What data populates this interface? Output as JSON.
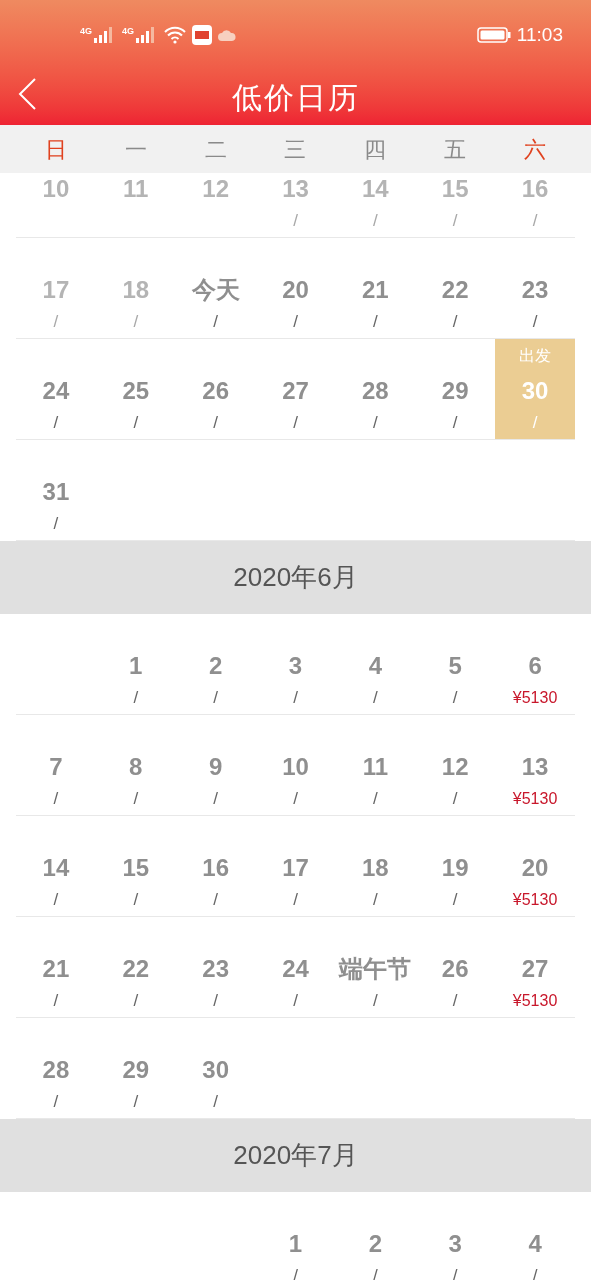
{
  "status_bar": {
    "network_1": "4G",
    "network_2": "4G",
    "time": "11:03"
  },
  "header": {
    "title": "低价日历"
  },
  "weekdays": [
    {
      "label": "日",
      "color": "#e0421f"
    },
    {
      "label": "一",
      "color": "#8a8a8a"
    },
    {
      "label": "二",
      "color": "#8a8a8a"
    },
    {
      "label": "三",
      "color": "#8a8a8a"
    },
    {
      "label": "四",
      "color": "#8a8a8a"
    },
    {
      "label": "五",
      "color": "#8a8a8a"
    },
    {
      "label": "六",
      "color": "#e0421f"
    }
  ],
  "months": [
    {
      "weeks": [
        [
          {
            "kind": "past",
            "day": "10"
          },
          {
            "kind": "past",
            "day": "11"
          },
          {
            "kind": "past",
            "day": "12"
          },
          {
            "kind": "past",
            "day": "13",
            "note": {
              "kind": "none",
              "text": "/"
            }
          },
          {
            "kind": "past",
            "day": "14",
            "note": {
              "kind": "none",
              "text": "/"
            }
          },
          {
            "kind": "past",
            "day": "15",
            "note": {
              "kind": "none",
              "text": "/"
            }
          },
          {
            "kind": "past",
            "day": "16",
            "note": {
              "kind": "none",
              "text": "/"
            }
          }
        ],
        [
          {
            "kind": "past",
            "day": "17",
            "note": {
              "kind": "none",
              "text": "/"
            }
          },
          {
            "kind": "past",
            "day": "18",
            "note": {
              "kind": "none",
              "text": "/"
            }
          },
          {
            "kind": "normal",
            "day": "今天",
            "note": {
              "kind": "none",
              "text": "/"
            }
          },
          {
            "kind": "normal",
            "day": "20",
            "note": {
              "kind": "none",
              "text": "/"
            }
          },
          {
            "kind": "normal",
            "day": "21",
            "note": {
              "kind": "none",
              "text": "/"
            }
          },
          {
            "kind": "normal",
            "day": "22",
            "note": {
              "kind": "none",
              "text": "/"
            }
          },
          {
            "kind": "normal",
            "day": "23",
            "note": {
              "kind": "none",
              "text": "/"
            }
          }
        ],
        [
          {
            "kind": "normal",
            "day": "24",
            "note": {
              "kind": "none",
              "text": "/"
            }
          },
          {
            "kind": "normal",
            "day": "25",
            "note": {
              "kind": "none",
              "text": "/"
            }
          },
          {
            "kind": "normal",
            "day": "26",
            "note": {
              "kind": "none",
              "text": "/"
            }
          },
          {
            "kind": "normal",
            "day": "27",
            "note": {
              "kind": "none",
              "text": "/"
            }
          },
          {
            "kind": "normal",
            "day": "28",
            "note": {
              "kind": "none",
              "text": "/"
            }
          },
          {
            "kind": "normal",
            "day": "29",
            "note": {
              "kind": "none",
              "text": "/"
            }
          },
          {
            "kind": "selected",
            "tag": "出发",
            "day": "30",
            "note": {
              "kind": "none",
              "text": "/"
            }
          }
        ],
        [
          {
            "kind": "normal",
            "day": "31",
            "note": {
              "kind": "none",
              "text": "/"
            }
          },
          {
            "kind": "empty"
          },
          {
            "kind": "empty"
          },
          {
            "kind": "empty"
          },
          {
            "kind": "empty"
          },
          {
            "kind": "empty"
          },
          {
            "kind": "empty"
          }
        ]
      ]
    },
    {
      "title": "2020年6月",
      "weeks": [
        [
          {
            "kind": "empty"
          },
          {
            "kind": "normal",
            "day": "1",
            "note": {
              "kind": "none",
              "text": "/"
            }
          },
          {
            "kind": "normal",
            "day": "2",
            "note": {
              "kind": "none",
              "text": "/"
            }
          },
          {
            "kind": "normal",
            "day": "3",
            "note": {
              "kind": "none",
              "text": "/"
            }
          },
          {
            "kind": "normal",
            "day": "4",
            "note": {
              "kind": "none",
              "text": "/"
            }
          },
          {
            "kind": "normal",
            "day": "5",
            "note": {
              "kind": "none",
              "text": "/"
            }
          },
          {
            "kind": "normal",
            "day": "6",
            "note": {
              "kind": "fare",
              "text": "¥5130"
            }
          }
        ],
        [
          {
            "kind": "normal",
            "day": "7",
            "note": {
              "kind": "none",
              "text": "/"
            }
          },
          {
            "kind": "normal",
            "day": "8",
            "note": {
              "kind": "none",
              "text": "/"
            }
          },
          {
            "kind": "normal",
            "day": "9",
            "note": {
              "kind": "none",
              "text": "/"
            }
          },
          {
            "kind": "normal",
            "day": "10",
            "note": {
              "kind": "none",
              "text": "/"
            }
          },
          {
            "kind": "normal",
            "day": "11",
            "note": {
              "kind": "none",
              "text": "/"
            }
          },
          {
            "kind": "normal",
            "day": "12",
            "note": {
              "kind": "none",
              "text": "/"
            }
          },
          {
            "kind": "normal",
            "day": "13",
            "note": {
              "kind": "fare",
              "text": "¥5130"
            }
          }
        ],
        [
          {
            "kind": "normal",
            "day": "14",
            "note": {
              "kind": "none",
              "text": "/"
            }
          },
          {
            "kind": "normal",
            "day": "15",
            "note": {
              "kind": "none",
              "text": "/"
            }
          },
          {
            "kind": "normal",
            "day": "16",
            "note": {
              "kind": "none",
              "text": "/"
            }
          },
          {
            "kind": "normal",
            "day": "17",
            "note": {
              "kind": "none",
              "text": "/"
            }
          },
          {
            "kind": "normal",
            "day": "18",
            "note": {
              "kind": "none",
              "text": "/"
            }
          },
          {
            "kind": "normal",
            "day": "19",
            "note": {
              "kind": "none",
              "text": "/"
            }
          },
          {
            "kind": "normal",
            "day": "20",
            "note": {
              "kind": "fare",
              "text": "¥5130"
            }
          }
        ],
        [
          {
            "kind": "normal",
            "day": "21",
            "note": {
              "kind": "none",
              "text": "/"
            }
          },
          {
            "kind": "normal",
            "day": "22",
            "note": {
              "kind": "none",
              "text": "/"
            }
          },
          {
            "kind": "normal",
            "day": "23",
            "note": {
              "kind": "none",
              "text": "/"
            }
          },
          {
            "kind": "normal",
            "day": "24",
            "note": {
              "kind": "none",
              "text": "/"
            }
          },
          {
            "kind": "normal",
            "day": "端午节",
            "note": {
              "kind": "none",
              "text": "/"
            }
          },
          {
            "kind": "normal",
            "day": "26",
            "note": {
              "kind": "none",
              "text": "/"
            }
          },
          {
            "kind": "normal",
            "day": "27",
            "note": {
              "kind": "fare",
              "text": "¥5130"
            }
          }
        ],
        [
          {
            "kind": "normal",
            "day": "28",
            "note": {
              "kind": "none",
              "text": "/"
            }
          },
          {
            "kind": "normal",
            "day": "29",
            "note": {
              "kind": "none",
              "text": "/"
            }
          },
          {
            "kind": "normal",
            "day": "30",
            "note": {
              "kind": "none",
              "text": "/"
            }
          },
          {
            "kind": "empty"
          },
          {
            "kind": "empty"
          },
          {
            "kind": "empty"
          },
          {
            "kind": "empty"
          }
        ]
      ]
    },
    {
      "title": "2020年7月",
      "weeks": [
        [
          {
            "kind": "empty"
          },
          {
            "kind": "empty"
          },
          {
            "kind": "empty"
          },
          {
            "kind": "normal",
            "day": "1",
            "note": {
              "kind": "none",
              "text": "/"
            }
          },
          {
            "kind": "normal",
            "day": "2",
            "note": {
              "kind": "none",
              "text": "/"
            }
          },
          {
            "kind": "normal",
            "day": "3",
            "note": {
              "kind": "none",
              "text": "/"
            }
          },
          {
            "kind": "normal",
            "day": "4",
            "note": {
              "kind": "none",
              "text": "/"
            }
          }
        ]
      ]
    }
  ]
}
